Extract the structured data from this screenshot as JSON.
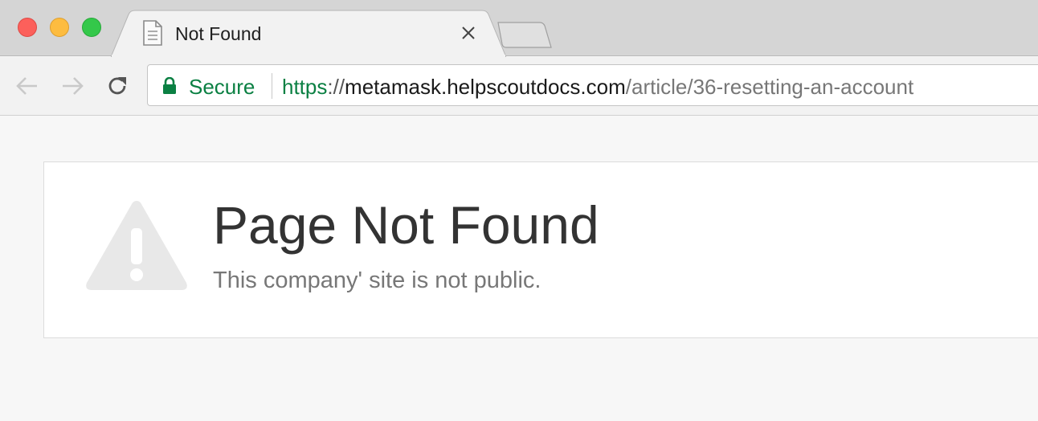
{
  "tab": {
    "title": "Not Found",
    "icon": "document-icon"
  },
  "toolbar": {
    "security_label": "Secure",
    "url": {
      "scheme": "https",
      "separator": "://",
      "host": "metamask.helpscoutdocs.com",
      "path": "/article/36-resetting-an-account"
    }
  },
  "page": {
    "title": "Page Not Found",
    "subtitle": "This company' site is not public.",
    "icon": "warning-icon"
  },
  "colors": {
    "secure_green": "#0b8043",
    "traffic_close": "#fc605b",
    "traffic_minimize": "#fdbc40",
    "traffic_maximize": "#34c84a"
  }
}
